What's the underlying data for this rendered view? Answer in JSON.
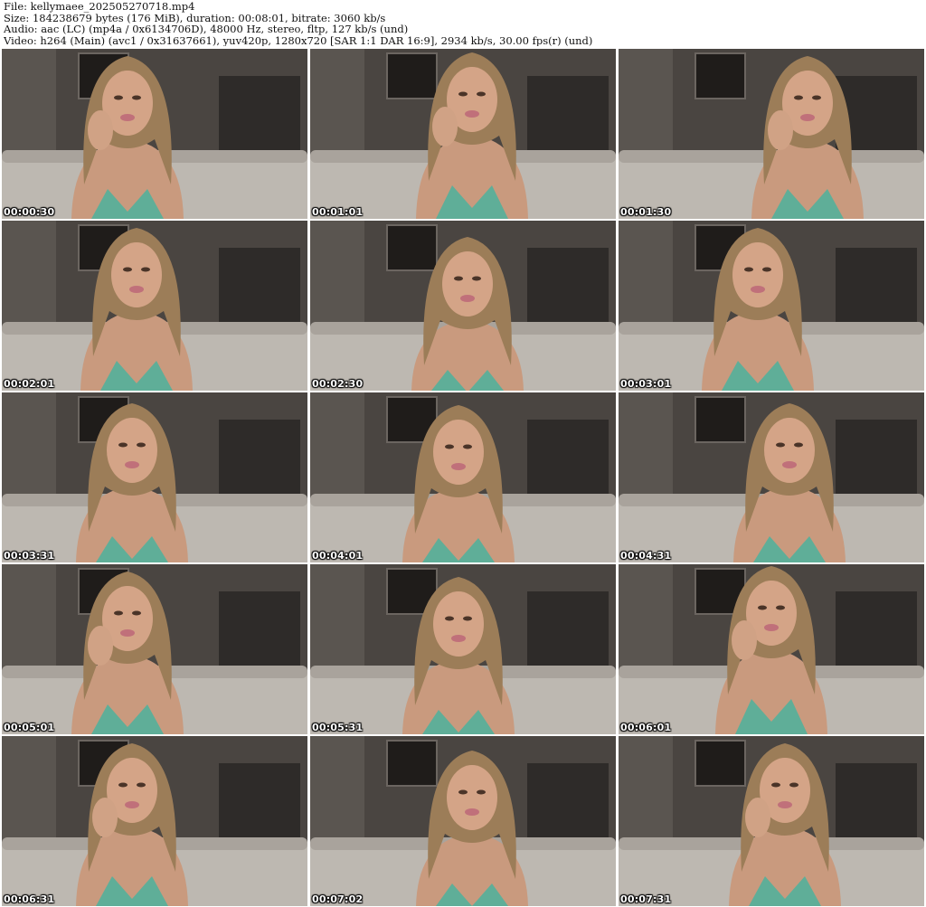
{
  "header": {
    "file_line": "File: kellymaee_202505270718.mp4",
    "size_line": "Size: 184238679 bytes (176 MiB), duration: 00:08:01, bitrate: 3060 kb/s",
    "audio_line": "Audio: aac (LC) (mp4a / 0x6134706D), 48000 Hz, stereo, fltp, 127 kb/s (und)",
    "video_line": "Video: h264 (Main) (avc1 / 0x31637661), yuv420p, 1280x720 [SAR 1:1 DAR 16:9], 2934 kb/s, 30.00 fps(r) (und)"
  },
  "thumbnails": [
    {
      "timestamp": "00:00:30"
    },
    {
      "timestamp": "00:01:01"
    },
    {
      "timestamp": "00:01:30"
    },
    {
      "timestamp": "00:02:01"
    },
    {
      "timestamp": "00:02:30"
    },
    {
      "timestamp": "00:03:01"
    },
    {
      "timestamp": "00:03:31"
    },
    {
      "timestamp": "00:04:01"
    },
    {
      "timestamp": "00:04:31"
    },
    {
      "timestamp": "00:05:01"
    },
    {
      "timestamp": "00:05:31"
    },
    {
      "timestamp": "00:06:01"
    },
    {
      "timestamp": "00:06:31"
    },
    {
      "timestamp": "00:07:02"
    },
    {
      "timestamp": "00:07:31"
    }
  ],
  "colors": {
    "wall": "#4a4541",
    "couch": "#bdb8b1",
    "skin": "#c99a7e",
    "hair": "#9c7d58",
    "top": "#5fae98"
  }
}
